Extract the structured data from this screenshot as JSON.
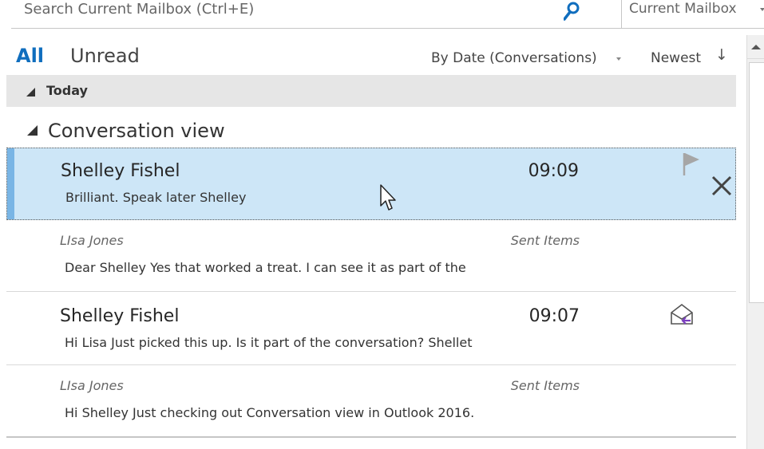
{
  "search": {
    "placeholder": "Search Current Mailbox (Ctrl+E)",
    "scope": "Current Mailbox"
  },
  "filters": {
    "all": "All",
    "unread": "Unread",
    "sort": "By Date (Conversations)",
    "order": "Newest",
    "order_arrow": "↓"
  },
  "group": {
    "label": "Today"
  },
  "conversation": {
    "label": "Conversation view"
  },
  "messages": [
    {
      "sender": "Shelley Fishel",
      "time": "09:09",
      "preview": "Brilliant.  Speak later  Shelley"
    },
    {
      "sender": "LIsa Jones",
      "folder": "Sent Items",
      "preview": "Dear Shelley  Yes that worked a treat. I can see it as part of the"
    },
    {
      "sender": "Shelley Fishel",
      "time": "09:07",
      "preview": "Hi Lisa  Just picked this up. Is it part of the conversation?  Shellet"
    },
    {
      "sender": "LIsa Jones",
      "folder": "Sent Items",
      "preview": "Hi Shelley  Just checking out Conversation view in Outlook 2016."
    }
  ],
  "colors": {
    "accent": "#106ebe",
    "selected_bg": "#cde6f7",
    "selected_bar": "#79b5e5",
    "group_bg": "#e6e6e6"
  },
  "icons": [
    "search-icon",
    "flag-icon",
    "delete-icon",
    "replied-icon",
    "mouse-cursor-icon"
  ]
}
